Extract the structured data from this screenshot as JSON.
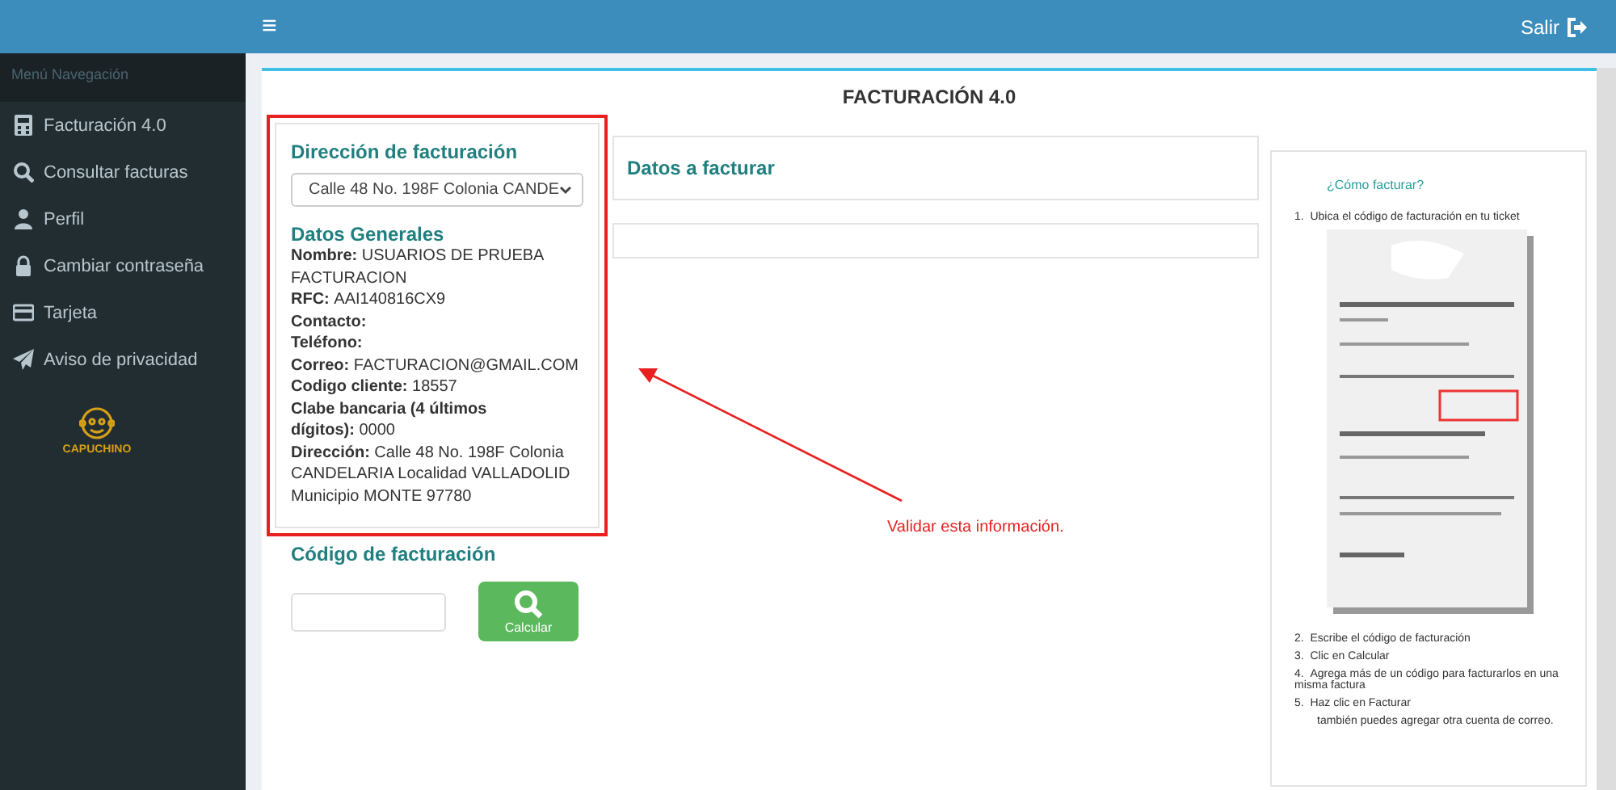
{
  "topbar": {
    "menu_glyph": "≡",
    "logout_label": "Salir"
  },
  "sidebar": {
    "header": "Menú Navegación",
    "items": [
      {
        "label": "Facturación 4.0",
        "kind": "calculator",
        "selected": false
      },
      {
        "label": "Consultar facturas",
        "kind": "search",
        "selected": false
      },
      {
        "label": "Perfil",
        "kind": "user",
        "selected": false
      },
      {
        "label": "Cambiar contraseña",
        "kind": "lock",
        "selected": false
      },
      {
        "label": "Tarjeta",
        "kind": "card",
        "selected": false
      },
      {
        "label": "Aviso de privacidad",
        "kind": "send",
        "selected": false
      }
    ],
    "logo_text": "CAPUCHINO"
  },
  "page_title": "FACTURACIÓN 4.0",
  "billing": {
    "heading": "Dirección de facturación",
    "address_select": "Calle 48 No. 198F Colonia CANDE",
    "general_heading": "Datos Generales",
    "fields": [
      {
        "label": "Nombre:",
        "value": "USUARIOS DE PRUEBA FACTURACION"
      },
      {
        "label": "RFC:",
        "value": "AAI140816CX9"
      },
      {
        "label": "Contacto:"
      },
      {
        "label": "Teléfono:"
      },
      {
        "label": "Correo:",
        "value": "FACTURACION@GMAIL.COM"
      },
      {
        "label": "Codigo cliente:",
        "value": "18557"
      },
      {
        "label": "Clabe bancaria (4 últimos dígitos):",
        "value": "0000"
      },
      {
        "label": "Dirección:",
        "value": "Calle 48 No. 198F Colonia CANDELARIA Localidad VALLADOLID Municipio MONTE 97780"
      }
    ]
  },
  "code": {
    "heading": "Código de facturación",
    "button": "Calcular"
  },
  "datos_a_facturar": {
    "heading": "Datos a facturar"
  },
  "annotation": {
    "text": "Validar esta información."
  },
  "help": {
    "title": "¿Cómo facturar?",
    "steps": [
      {
        "number": "1.",
        "text": "Ubica el código de facturación en tu ticket",
        "kind": "with_ticket"
      },
      {
        "number": "2.",
        "text": "Escribe el código de facturación",
        "kind": "plain"
      },
      {
        "number": "3.",
        "text": "Clic en Calcular",
        "kind": "plain"
      },
      {
        "number": "4.",
        "text": "Agrega más de un código para facturarlos en una misma factura",
        "kind": "plain"
      },
      {
        "number": "5.",
        "text": "Haz clic en Facturar",
        "kind": "plain"
      }
    ],
    "trailing_line": "también puedes agregar otra cuenta de correo."
  }
}
